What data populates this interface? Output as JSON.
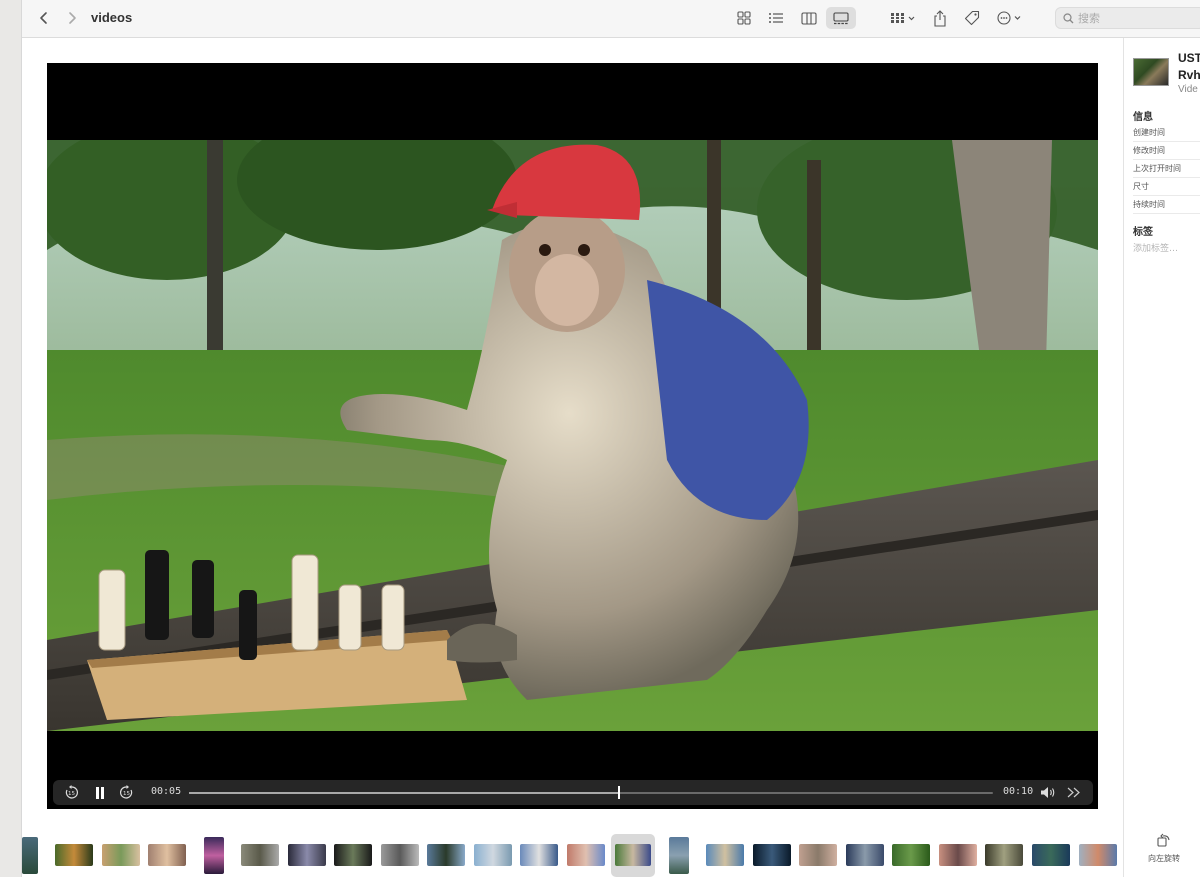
{
  "toolbar": {
    "folder_title": "videos",
    "search_placeholder": "搜索",
    "icons": [
      "chevron-left-icon",
      "chevron-right-icon",
      "icon-view-icon",
      "list-view-icon",
      "column-view-icon",
      "gallery-view-icon",
      "group-icon",
      "share-icon",
      "tag-icon",
      "more-icon",
      "search-icon"
    ]
  },
  "player": {
    "current_time": "00:05",
    "total_time": "00:10",
    "progress": 0.535,
    "state": "playing"
  },
  "inspector": {
    "file_name": "UST\nRvh",
    "file_kind": "Vide",
    "info_heading": "信息",
    "info_rows": [
      "创建时间",
      "修改时间",
      "上次打开时间",
      "尺寸",
      "持续时间"
    ],
    "tags_heading": "标签",
    "add_tag_placeholder": "添加标签…",
    "rotate_label": "向左旋转"
  },
  "filmstrip": {
    "selected_index": 13,
    "count": 24
  },
  "colors": {
    "selection": "#d9d9d9",
    "toolbar_bg": "#f6f6f6",
    "control_bar": "#282828"
  }
}
